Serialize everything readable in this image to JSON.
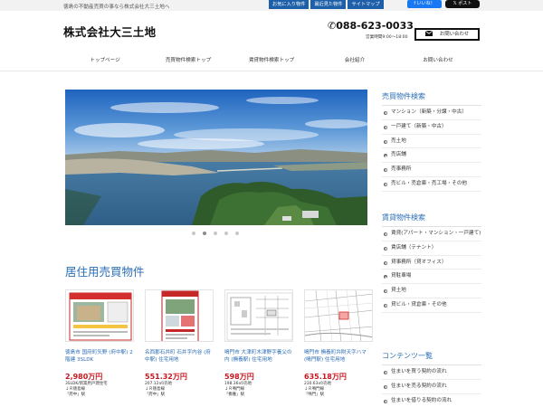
{
  "header": {
    "tagline": "徳島の不動産売買の事なら株式会社大三土地へ",
    "top_links": [
      "お気に入り物件",
      "最近見た物件",
      "サイトマップ"
    ],
    "fb_label": "いいね！",
    "x_label": "ポスト",
    "logo": "株式会社大三土地",
    "phone": "088-623-0033",
    "hours": "営業時間9:00～18:00",
    "contact_label": "お問い合わせ"
  },
  "nav": [
    "トップページ",
    "売買物件検索トップ",
    "賃貸物件検索トップ",
    "会社紹介",
    "お問い合わせ"
  ],
  "slider": {
    "dots": 6,
    "active": 1
  },
  "section_title": "居住用売買物件",
  "cards": [
    {
      "title": "徳島市 国府町矢野 (府中駅) 2階建 3SLDK",
      "price": "2,980万円",
      "detail": "3SLDK/新築用戸建住宅",
      "line1": "ＪＲ徳島線",
      "line2": "「府中」駅"
    },
    {
      "title": "名西郡石井町 石井字内谷 (府中駅) 住宅用地",
      "price": "551.32万円",
      "detail": "207.12㎡/売地",
      "line1": "ＪＲ徳島線",
      "line2": "「府中」駅"
    },
    {
      "title": "鳴門市 大津町木津野字養父の内 (撫養駅) 住宅用地",
      "price": "598万円",
      "detail": "198.36㎡/売地",
      "line1": "ＪＲ鳴門線",
      "line2": "「撫養」駅"
    },
    {
      "title": "鳴門市 撫養町弁財天字ハマ (鳴門駅) 住宅用地",
      "price": "635.18万円",
      "detail": "230.63㎡/売地",
      "line1": "ＪＲ鳴門線",
      "line2": "「鳴門」駅"
    }
  ],
  "sidebar": {
    "sale": {
      "title": "売買物件検索",
      "items": [
        "マンション（新築・分譲・中古）",
        "一戸建て（新築・中古）",
        "売土地",
        "売店舗",
        "売事務所",
        "売ビル・売倉庫・売工場・その他"
      ]
    },
    "rent": {
      "title": "賃貸物件検索",
      "items": [
        "賃貸(アパート・マンション・一戸建て)",
        "賃店舗（テナント）",
        "貸事務所（貸オフィス）",
        "貸駐車場",
        "貸土地",
        "貸ビル・貸倉庫・その他"
      ]
    },
    "contents": {
      "title": "コンテンツ一覧",
      "items": [
        "住まいを買う契約の流れ",
        "住まいを売る契約の流れ",
        "住まいを借りる契約の流れ"
      ]
    }
  },
  "colors": {
    "accent": "#2a6db5",
    "price": "#c9161f",
    "top_link_bg": "#1d5fa8"
  }
}
